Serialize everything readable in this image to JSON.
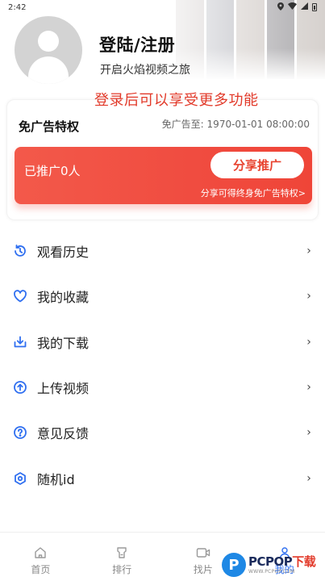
{
  "status_bar": {
    "time": "2:42",
    "icons": [
      "location-icon",
      "wifi-icon",
      "signal-icon",
      "battery-icon"
    ]
  },
  "profile": {
    "title": "登陆/注册",
    "subtitle": "开启火焰视频之旅",
    "hint": "登录后可以享受更多功能"
  },
  "adfree": {
    "title": "免广告特权",
    "expiry_label": "免广告至:",
    "expiry_value": "1970-01-01 08:00:00",
    "promo_count": "已推广0人",
    "share_button": "分享推广",
    "promo_desc": "分享可得终身免广告特权>"
  },
  "menu": {
    "items": [
      {
        "label": "观看历史",
        "icon": "history-icon"
      },
      {
        "label": "我的收藏",
        "icon": "heart-icon"
      },
      {
        "label": "我的下载",
        "icon": "download-icon"
      },
      {
        "label": "上传视频",
        "icon": "upload-icon"
      },
      {
        "label": "意见反馈",
        "icon": "question-icon"
      },
      {
        "label": "随机id",
        "icon": "hexagon-icon"
      }
    ]
  },
  "bottom_nav": {
    "tabs": [
      {
        "label": "首页",
        "icon": "home-icon",
        "active": false
      },
      {
        "label": "排行",
        "icon": "rank-icon",
        "active": false
      },
      {
        "label": "找片",
        "icon": "video-icon",
        "active": false
      },
      {
        "label": "我的",
        "icon": "person-icon",
        "active": true
      }
    ]
  },
  "watermark": {
    "main_text": "PCPOP",
    "accent_text": "下载",
    "sub_text": "WWW.PCPOP.COM"
  },
  "colors": {
    "accent_blue": "#2f6ff0",
    "promo_red": "#f04c40",
    "hint_red": "#e23a2a"
  }
}
